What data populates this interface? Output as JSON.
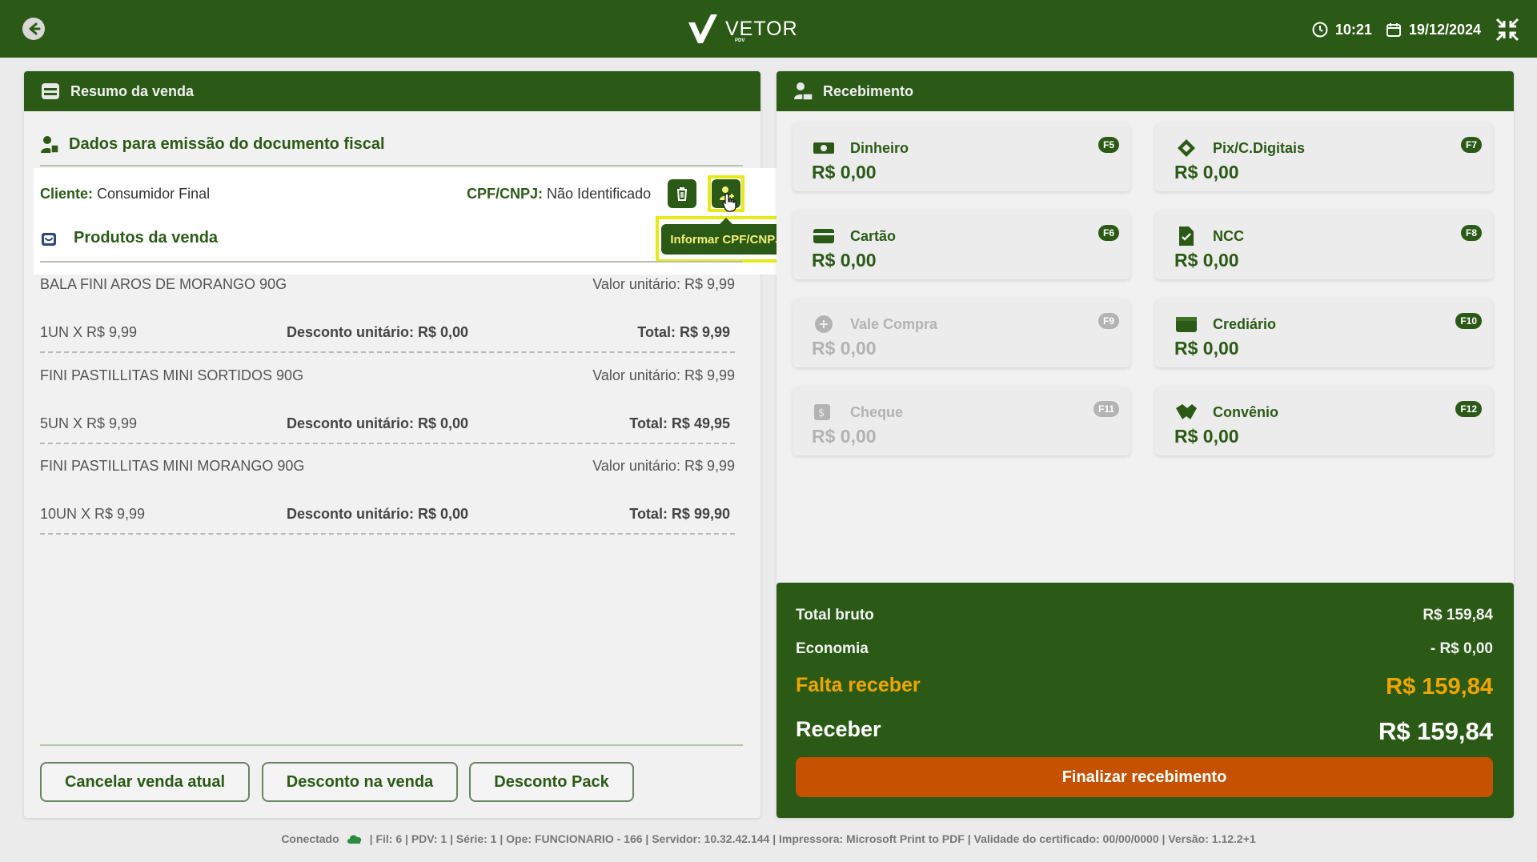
{
  "topbar": {
    "logo_text": "VETOR",
    "logo_sub": "PDV",
    "time": "10:21",
    "date": "19/12/2024"
  },
  "left": {
    "header": "Resumo da venda",
    "fiscal_title": "Dados para emissão do documento fiscal",
    "cliente_label": "Cliente:",
    "cliente_value": "Consumidor Final",
    "cpf_label": "CPF/CNPJ:",
    "cpf_value": "Não Identificado",
    "tooltip": "Informar CPF/CNPJ",
    "products_title": "Produtos da venda",
    "products": [
      {
        "name": "BALA FINI AROS DE MORANGO 90G",
        "unit": "Valor unitário: R$ 9,99",
        "qty": "1UN X R$ 9,99",
        "discount": "Desconto unitário: R$ 0,00",
        "total": "Total: R$ 9,99"
      },
      {
        "name": "FINI PASTILLITAS MINI SORTIDOS 90G",
        "unit": "Valor unitário: R$ 9,99",
        "qty": "5UN X R$ 9,99",
        "discount": "Desconto unitário: R$ 0,00",
        "total": "Total: R$ 49,95"
      },
      {
        "name": "FINI PASTILLITAS MINI MORANGO 90G",
        "unit": "Valor unitário: R$ 9,99",
        "qty": "10UN X R$ 9,99",
        "discount": "Desconto unitário: R$ 0,00",
        "total": "Total: R$ 99,90"
      }
    ],
    "buttons": {
      "cancel": "Cancelar venda atual",
      "discount": "Desconto na venda",
      "pack": "Desconto Pack"
    }
  },
  "right": {
    "header": "Recebimento",
    "tiles": [
      {
        "name": "Dinheiro",
        "value": "R$ 0,00",
        "key": "F5"
      },
      {
        "name": "Pix/C.Digitais",
        "value": "R$ 0,00",
        "key": "F7"
      },
      {
        "name": "Cartão",
        "value": "R$ 0,00",
        "key": "F6"
      },
      {
        "name": "NCC",
        "value": "R$ 0,00",
        "key": "F8"
      },
      {
        "name": "Vale Compra",
        "value": "R$ 0,00",
        "key": "F9"
      },
      {
        "name": "Crediário",
        "value": "R$ 0,00",
        "key": "F10"
      },
      {
        "name": "Cheque",
        "value": "R$ 0,00",
        "key": "F11"
      },
      {
        "name": "Convênio",
        "value": "R$ 0,00",
        "key": "F12"
      }
    ],
    "totals": {
      "bruto_label": "Total bruto",
      "bruto_value": "R$ 159,84",
      "economia_label": "Economia",
      "economia_value": "- R$ 0,00",
      "falta_label": "Falta receber",
      "falta_value": "R$ 159,84",
      "receber_label": "Receber",
      "receber_value": "R$ 159,84"
    },
    "finalize": "Finalizar recebimento"
  },
  "footer": {
    "status": "Conectado",
    "info": "| Fil: 6 | PDV: 1 | Série: 1 | Ope: FUNCIONARIO - 166 | Servidor: 10.32.42.144 | Impressora: Microsoft Print to PDF | Validade do certificado: 00/00/0000 | Versão: 1.12.2+1"
  },
  "colors": {
    "brand_green": "#2b5a16",
    "accent_orange": "#c45200",
    "highlight_yellow": "#e6ea1a",
    "falta_orange": "#f0a400"
  }
}
